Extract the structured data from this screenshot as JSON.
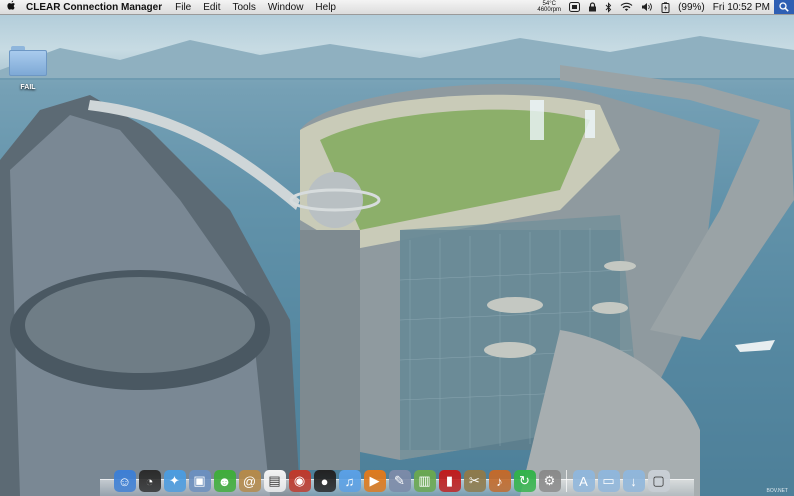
{
  "menubar": {
    "app_name": "CLEAR Connection Manager",
    "menus": [
      "File",
      "Edit",
      "Tools",
      "Window",
      "Help"
    ],
    "sensor": {
      "temperature": "54°C",
      "fan": "4600rpm"
    },
    "battery_percent": "(99%)",
    "clock": "Fri 10:52 PM"
  },
  "desktop": {
    "icons": [
      {
        "label": "FAIL",
        "icon": "folder-icon"
      }
    ]
  },
  "dock": {
    "items": [
      {
        "icon": "finder-icon",
        "color": "#3d7fd6"
      },
      {
        "icon": "dashboard-icon",
        "color": "#2b2b2b"
      },
      {
        "icon": "safari-icon",
        "color": "#4b9ce0"
      },
      {
        "icon": "preview-icon",
        "color": "#6b8fbf"
      },
      {
        "icon": "chat-icon",
        "color": "#3fae3a"
      },
      {
        "icon": "address-book-icon",
        "color": "#b58a4a"
      },
      {
        "icon": "calendar-icon",
        "color": "#f4f4f4"
      },
      {
        "icon": "photo-booth-icon",
        "color": "#c0392b"
      },
      {
        "icon": "camera-icon",
        "color": "#222222"
      },
      {
        "icon": "itunes-icon",
        "color": "#5aa0e6"
      },
      {
        "icon": "front-row-icon",
        "color": "#e07a1c"
      },
      {
        "icon": "pen-tool-icon",
        "color": "#7c8aa8"
      },
      {
        "icon": "activity-monitor-icon",
        "color": "#6aa84f"
      },
      {
        "icon": "flash-card-icon",
        "color": "#c21d1d"
      },
      {
        "icon": "tools-icon",
        "color": "#8f7a4a"
      },
      {
        "icon": "guitar-icon",
        "color": "#c46a2a"
      },
      {
        "icon": "sync-icon",
        "color": "#32b34a"
      },
      {
        "icon": "system-utility-icon",
        "color": "#8a8a8a"
      },
      {
        "icon": "applications-folder-icon",
        "color": "#8fb6dc"
      },
      {
        "icon": "documents-folder-icon",
        "color": "#8fb6dc"
      },
      {
        "icon": "downloads-folder-icon",
        "color": "#8fb6dc"
      },
      {
        "icon": "trash-icon",
        "color": "#c9cfd6"
      }
    ],
    "separator_after": 17
  },
  "wallpaper": {
    "credit": "BOV.NET"
  }
}
